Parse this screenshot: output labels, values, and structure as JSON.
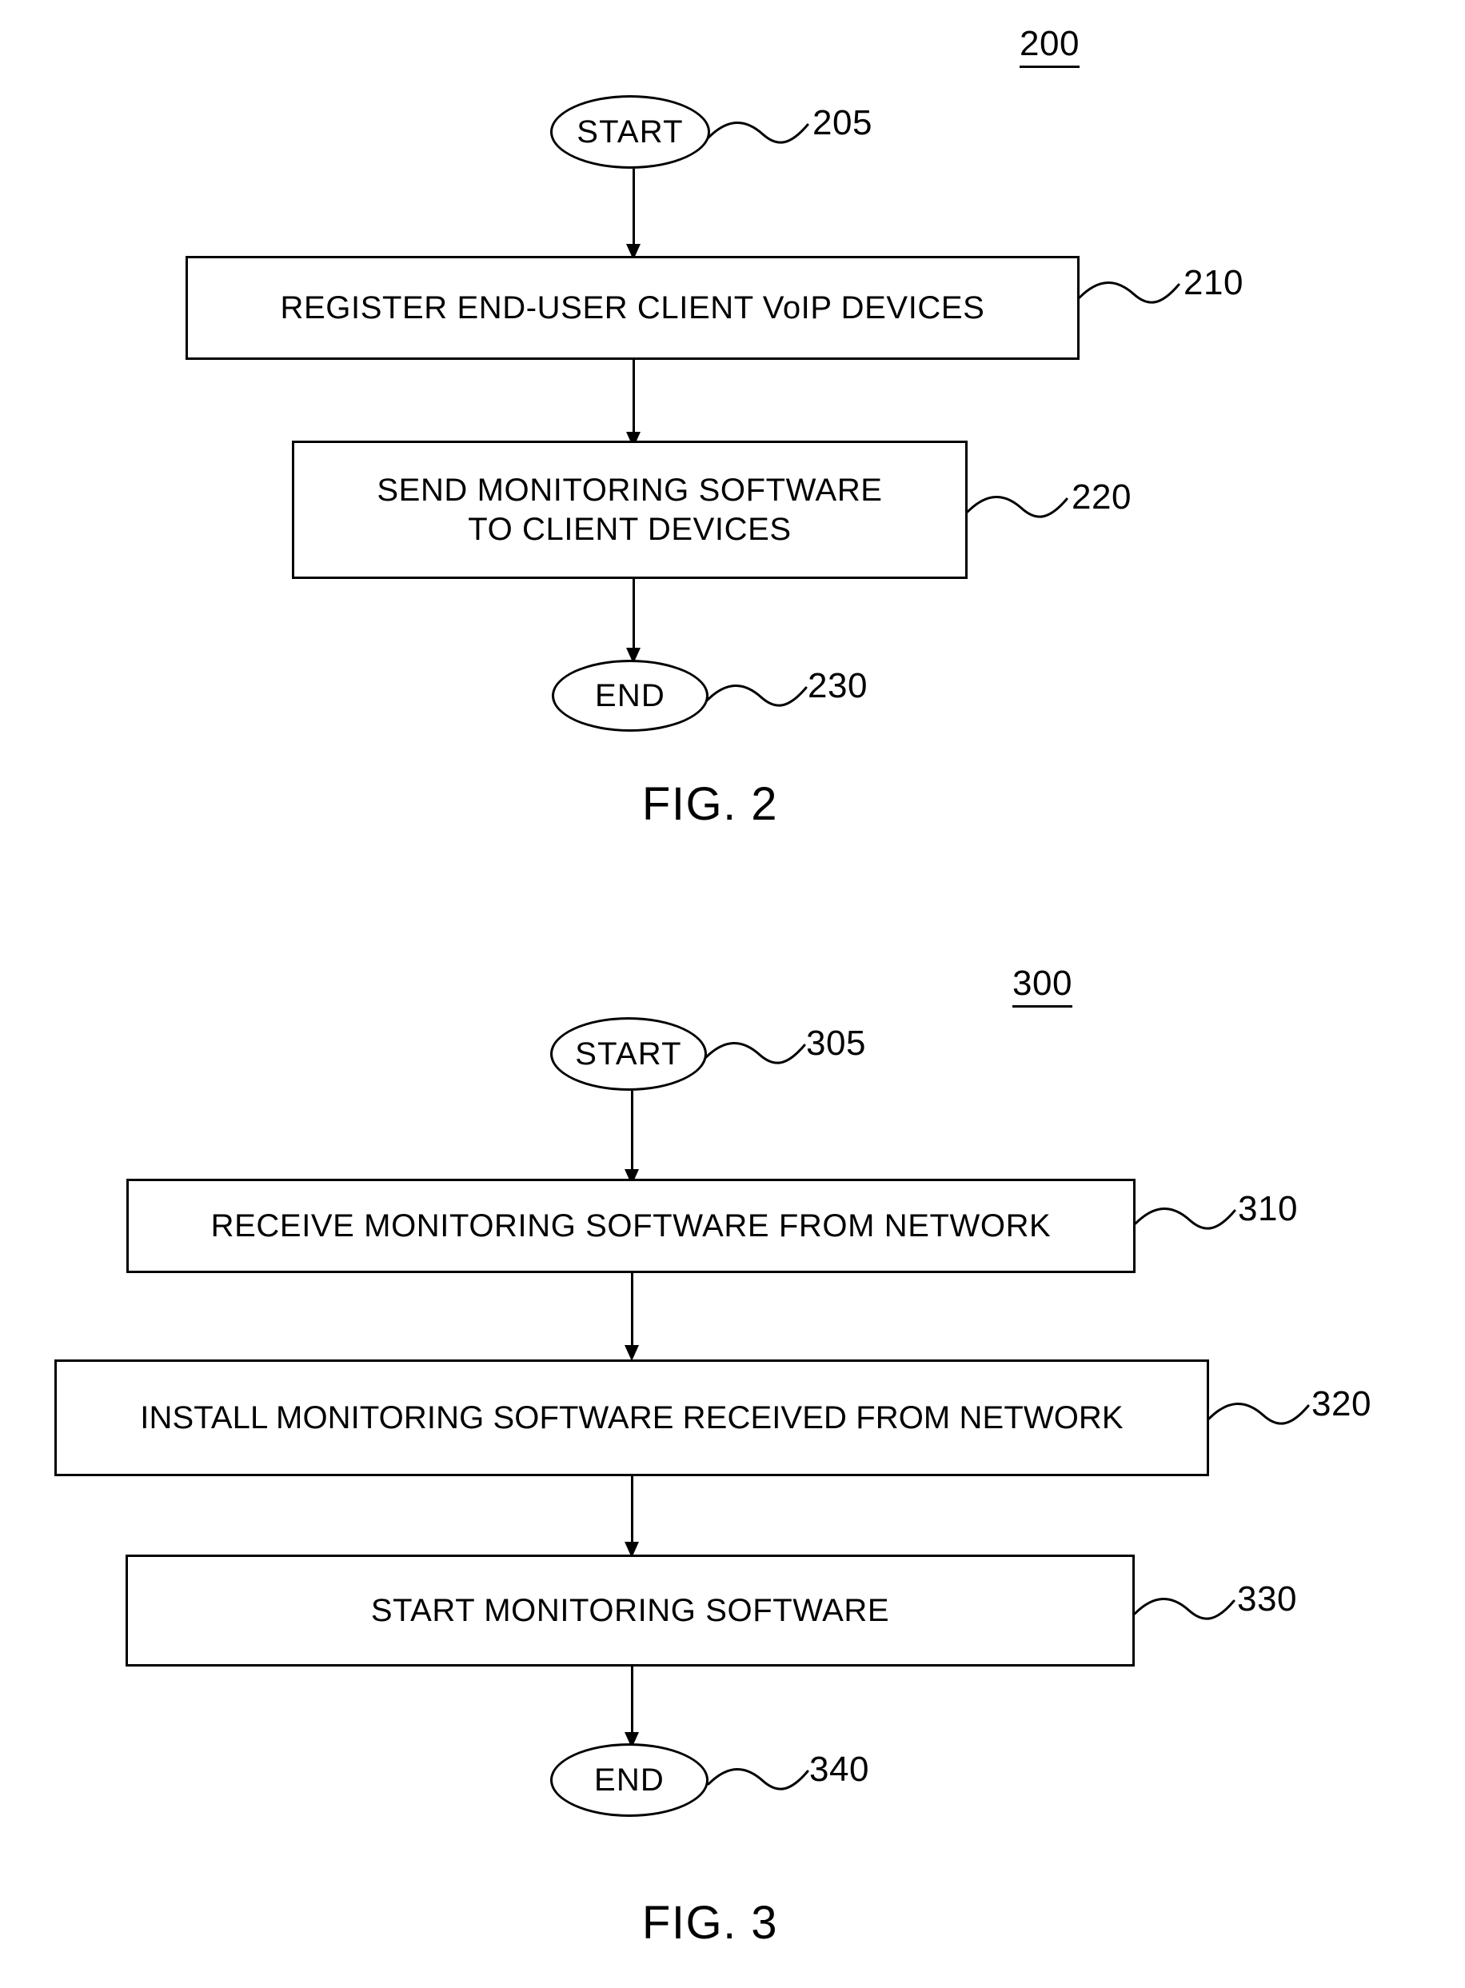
{
  "document": {
    "type": "patent-drawing-sheet",
    "background_color": "#ffffff",
    "ink_color": "#000000"
  },
  "figures": [
    {
      "caption": "FIG. 2",
      "reference_numeral": "200",
      "nodes": [
        {
          "id": "start-2",
          "shape": "ellipse",
          "label": "START",
          "callout": "205"
        },
        {
          "id": "step-210",
          "shape": "rectangle",
          "label": "REGISTER END-USER CLIENT VoIP DEVICES",
          "callout": "210"
        },
        {
          "id": "step-220",
          "shape": "rectangle",
          "label": "SEND MONITORING SOFTWARE\nTO CLIENT DEVICES",
          "callout": "220"
        },
        {
          "id": "end-2",
          "shape": "ellipse",
          "label": "END",
          "callout": "230"
        }
      ],
      "edges": [
        {
          "from": "start-2",
          "to": "step-210",
          "arrow": "down"
        },
        {
          "from": "step-210",
          "to": "step-220",
          "arrow": "down"
        },
        {
          "from": "step-220",
          "to": "end-2",
          "arrow": "down"
        }
      ]
    },
    {
      "caption": "FIG. 3",
      "reference_numeral": "300",
      "nodes": [
        {
          "id": "start-3",
          "shape": "ellipse",
          "label": "START",
          "callout": "305"
        },
        {
          "id": "step-310",
          "shape": "rectangle",
          "label": "RECEIVE MONITORING SOFTWARE FROM NETWORK",
          "callout": "310"
        },
        {
          "id": "step-320",
          "shape": "rectangle",
          "label": "INSTALL MONITORING SOFTWARE RECEIVED FROM NETWORK",
          "callout": "320"
        },
        {
          "id": "step-330",
          "shape": "rectangle",
          "label": "START MONITORING SOFTWARE",
          "callout": "330"
        },
        {
          "id": "end-3",
          "shape": "ellipse",
          "label": "END",
          "callout": "340"
        }
      ],
      "edges": [
        {
          "from": "start-3",
          "to": "step-310",
          "arrow": "down"
        },
        {
          "from": "step-310",
          "to": "step-320",
          "arrow": "down"
        },
        {
          "from": "step-320",
          "to": "step-330",
          "arrow": "down"
        },
        {
          "from": "step-330",
          "to": "end-3",
          "arrow": "down"
        }
      ]
    }
  ]
}
